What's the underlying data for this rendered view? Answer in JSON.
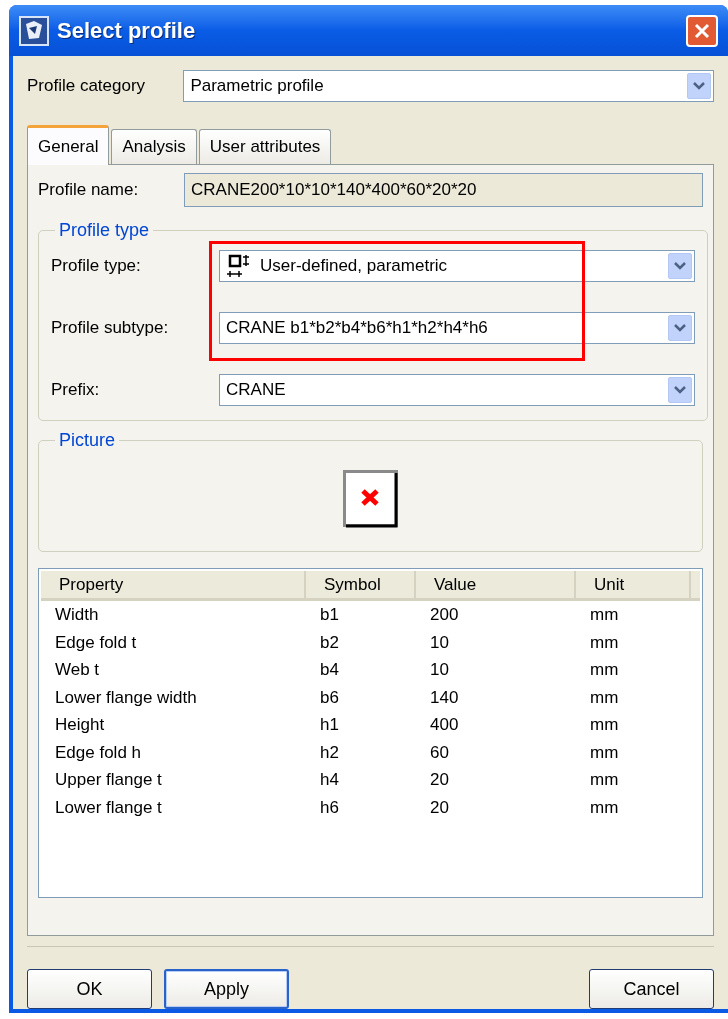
{
  "window": {
    "title": "Select profile"
  },
  "profile_category": {
    "label": "Profile category",
    "value": "Parametric profile"
  },
  "tabs": [
    {
      "label": "General",
      "selected": true
    },
    {
      "label": "Analysis",
      "selected": false
    },
    {
      "label": "User attributes",
      "selected": false
    }
  ],
  "profile_name": {
    "label": "Profile name:",
    "value": "CRANE200*10*10*140*400*60*20*20"
  },
  "profile_type_group": {
    "title": "Profile type",
    "fields": [
      {
        "label": "Profile type:",
        "value": "User-defined, parametric",
        "kind": "icon_dropdown",
        "highlighted": true
      },
      {
        "label": "Profile subtype:",
        "value": "CRANE b1*b2*b4*b6*h1*h2*h4*h6",
        "kind": "dropdown",
        "highlighted": true
      },
      {
        "label": "Prefix:",
        "value": "CRANE",
        "kind": "dropdown",
        "highlighted": false
      }
    ]
  },
  "picture_group": {
    "title": "Picture"
  },
  "table": {
    "columns": [
      "Property",
      "Symbol",
      "Value",
      "Unit"
    ],
    "rows": [
      [
        "Width",
        "b1",
        "200",
        "mm"
      ],
      [
        "Edge fold t",
        "b2",
        "10",
        "mm"
      ],
      [
        "Web t",
        "b4",
        "10",
        "mm"
      ],
      [
        "Lower flange width",
        "b6",
        "140",
        "mm"
      ],
      [
        "Height",
        "h1",
        "400",
        "mm"
      ],
      [
        "Edge fold h",
        "h2",
        "60",
        "mm"
      ],
      [
        "Upper flange t",
        "h4",
        "20",
        "mm"
      ],
      [
        "Lower flange t",
        "h6",
        "20",
        "mm"
      ]
    ]
  },
  "buttons": [
    {
      "label": "OK",
      "focused": false
    },
    {
      "label": "Apply",
      "focused": true
    }
  ],
  "right_buttons": [
    {
      "label": "Cancel",
      "focused": false
    }
  ]
}
